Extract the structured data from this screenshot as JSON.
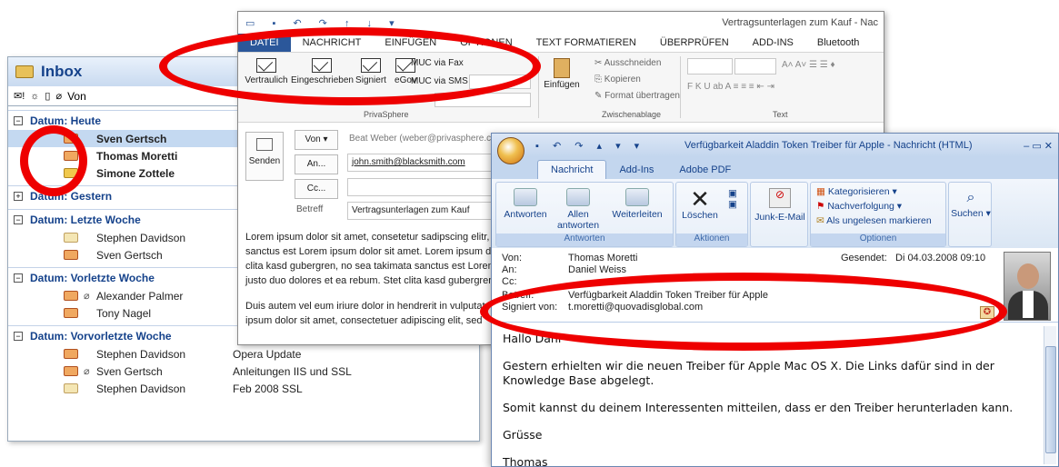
{
  "inbox": {
    "title": "Inbox",
    "columns_label": "Von",
    "groups": [
      {
        "label": "Datum: Heute",
        "toggle": "−",
        "rows": [
          {
            "sender": "Sven Gertsch",
            "subject": "",
            "bold": true,
            "selected": true,
            "icon": "certificate-mail-icon",
            "attachment": false
          },
          {
            "sender": "Thomas Moretti",
            "subject": "",
            "bold": true,
            "selected": false,
            "icon": "certificate-mail-icon",
            "attachment": false
          },
          {
            "sender": "Simone Zottele",
            "subject": "",
            "bold": true,
            "selected": false,
            "icon": "closed-mail-icon",
            "attachment": false
          }
        ]
      },
      {
        "label": "Datum: Gestern",
        "toggle": "+",
        "rows": []
      },
      {
        "label": "Datum: Letzte Woche",
        "toggle": "−",
        "rows": [
          {
            "sender": "Stephen Davidson",
            "subject": "",
            "bold": false,
            "icon": "open-mail-icon",
            "attachment": false
          },
          {
            "sender": "Sven Gertsch",
            "subject": "",
            "bold": false,
            "icon": "certificate-mail-icon",
            "attachment": false
          }
        ]
      },
      {
        "label": "Datum: Vorletzte Woche",
        "toggle": "−",
        "rows": [
          {
            "sender": "Alexander Palmer",
            "subject": "",
            "bold": false,
            "icon": "certificate-mail-icon",
            "attachment": true
          },
          {
            "sender": "Tony Nagel",
            "subject": "",
            "bold": false,
            "icon": "certificate-mail-icon",
            "attachment": false
          }
        ]
      },
      {
        "label": "Datum: Vorvorletzte Woche",
        "toggle": "−",
        "rows": [
          {
            "sender": "Stephen Davidson",
            "subject": "Opera Update",
            "bold": false,
            "icon": "certificate-mail-icon",
            "attachment": false
          },
          {
            "sender": "Sven Gertsch",
            "subject": "Anleitungen IIS und SSL",
            "bold": false,
            "icon": "certificate-mail-icon",
            "attachment": true
          },
          {
            "sender": "Stephen Davidson",
            "subject": "Feb 2008 SSL",
            "bold": false,
            "icon": "open-mail-icon",
            "attachment": false
          }
        ]
      }
    ]
  },
  "compose": {
    "window_title": "Vertragsunterlagen zum Kauf - Nac",
    "tabs": [
      "DATEI",
      "NACHRICHT",
      "EINFÜGEN",
      "OPTIONEN",
      "TEXT FORMATIEREN",
      "ÜBERPRÜFEN",
      "ADD-INS",
      "Bluetooth"
    ],
    "privasphere": {
      "buttons": [
        "Vertraulich",
        "Eingeschrieben",
        "Signiert",
        "eGov"
      ],
      "muc_fax": "MUC via Fax",
      "muc_sms": "MUC via SMS",
      "muc": "MUC",
      "group_label": "PrivaSphere"
    },
    "clipboard": {
      "paste": "Einfügen",
      "cut": "Ausschneiden",
      "copy": "Kopieren",
      "format": "Format übertragen",
      "group_label": "Zwischenablage"
    },
    "text_group_label": "Text",
    "send_label": "Senden",
    "from_label": "Von",
    "from_value": "Beat Weber (weber@privasphere.com)",
    "to_label": "An...",
    "to_value": "john.smith@blacksmith.com",
    "cc_label": "Cc...",
    "subject_label": "Betreff",
    "subject_value": "Vertragsunterlagen zum Kauf",
    "body_p1": "Lorem ipsum dolor sit amet, consetetur sadipscing elitr, sanctus est Lorem ipsum dolor sit amet. Lorem ipsum dolor clita kasd gubergren, no sea takimata sanctus est Lorem justo duo dolores et ea rebum. Stet clita kasd gubergren,",
    "body_p2": "Duis autem vel eum iriure dolor in hendrerit in vulputate ipsum dolor sit amet, consectetuer adipiscing elit, sed"
  },
  "message": {
    "window_title": "Verfügbarkeit Aladdin Token Treiber für Apple - Nachricht (HTML)",
    "tabs": [
      "Nachricht",
      "Add-Ins",
      "Adobe PDF"
    ],
    "respond": {
      "reply": "Antworten",
      "reply_all": "Allen antworten",
      "forward": "Weiterleiten",
      "group": "Antworten"
    },
    "actions": {
      "delete": "Löschen",
      "group": "Aktionen"
    },
    "junk": "Junk-E-Mail",
    "options": {
      "categorize": "Kategorisieren",
      "followup": "Nachverfolgung",
      "unread": "Als ungelesen markieren",
      "group": "Optionen"
    },
    "find": "Suchen",
    "headers": {
      "from_label": "Von:",
      "from": "Thomas Moretti",
      "to_label": "An:",
      "to": "Daniel Weiss",
      "cc_label": "Cc:",
      "subject_label": "Betreff:",
      "subject": "Verfügbarkeit Aladdin Token Treiber für Apple",
      "signed_label": "Signiert von:",
      "signed": "t.moretti@quovadisglobal.com",
      "sent_label": "Gesendet:",
      "sent": "Di 04.03.2008 09:10"
    },
    "body": {
      "greeting": "Hallo Dani",
      "p1": "Gestern erhielten wir die neuen Treiber für Apple Mac OS X. Die Links dafür sind in der Knowledge Base abgelegt.",
      "p2": "Somit kannst du deinem Interessenten mitteilen, dass er den Treiber herunterladen kann.",
      "closing": "Grüsse",
      "signature": "Thomas"
    }
  },
  "colors": {
    "annotation_red": "#e00000",
    "outlook_blue": "#15428b",
    "office_blue": "#2b579a"
  }
}
